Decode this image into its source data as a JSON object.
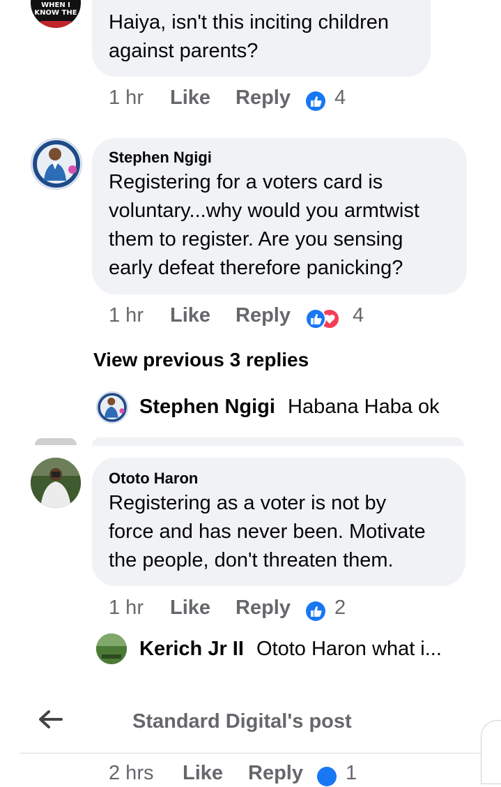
{
  "comments": [
    {
      "author": "",
      "text_lines": [
        "Haiya, isn't this inciting children",
        "against parents?"
      ],
      "time": "1 hr",
      "like": "Like",
      "reply": "Reply",
      "reactions": "4",
      "avatar_text": [
        "WHEN I",
        "KNOW THE"
      ]
    },
    {
      "author": "Stephen Ngigi",
      "text_lines": [
        "Registering for a voters card is",
        "voluntary...why would you armtwist",
        "them to register. Are you sensing",
        "early defeat therefore panicking?"
      ],
      "time": "1 hr",
      "like": "Like",
      "reply": "Reply",
      "reactions": "4"
    },
    {
      "author": "Ototo Haron",
      "text_lines": [
        "Registering as a voter is not by",
        "force and has never been. Motivate",
        "the people, don't threaten them."
      ],
      "time": "1 hr",
      "like": "Like",
      "reply": "Reply",
      "reactions": "2"
    }
  ],
  "view_previous": "View previous 3 replies",
  "replies": [
    {
      "name": "Stephen Ngigi",
      "text": "Habana Haba ok"
    },
    {
      "name": "Kerich Jr II",
      "text": "Ototo Haron what i..."
    }
  ],
  "footer": {
    "title": "Standard Digital's post",
    "back_icon": "back-arrow-icon",
    "peek": {
      "time": "2 hrs",
      "like": "Like",
      "reply": "Reply",
      "reactions": "1"
    }
  },
  "colors": {
    "like_blue": "#1877f2",
    "love_red": "#f33e58",
    "bubble": "#f0f2f5",
    "meta_gray": "#65676b"
  }
}
